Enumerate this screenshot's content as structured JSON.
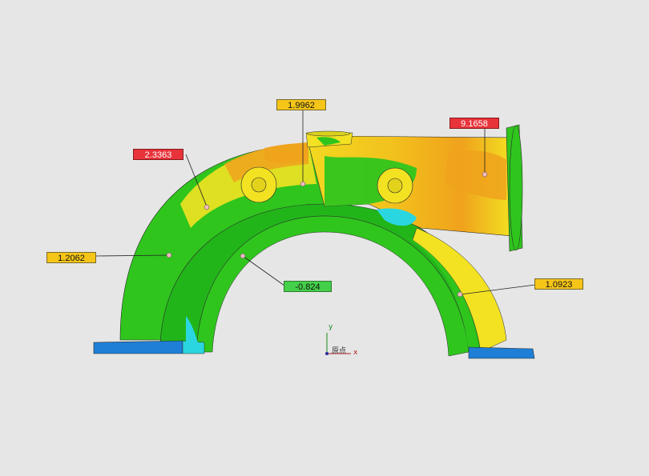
{
  "colors": {
    "background": "#e6e6e6",
    "label_yellow": "#f5c518",
    "label_red": "#e8333a",
    "label_green": "#44d04a",
    "deviation_green": "#2fc51d",
    "deviation_yellow": "#f2e222",
    "deviation_orange": "#f0a21c",
    "deviation_blue": "#1f7fd6",
    "deviation_cyan": "#2ad6e0"
  },
  "annotations": [
    {
      "id": "a1",
      "value": "1.9962",
      "color": "yellow"
    },
    {
      "id": "a2",
      "value": "9.1658",
      "color": "red"
    },
    {
      "id": "a3",
      "value": "2.3363",
      "color": "red"
    },
    {
      "id": "a4",
      "value": "1.2062",
      "color": "yellow"
    },
    {
      "id": "a5",
      "value": "-0.824",
      "color": "green"
    },
    {
      "id": "a6",
      "value": "1.0923",
      "color": "yellow"
    }
  ],
  "axis_triad": {
    "y_label": "y",
    "x_label": "x",
    "origin_label": "原点"
  }
}
